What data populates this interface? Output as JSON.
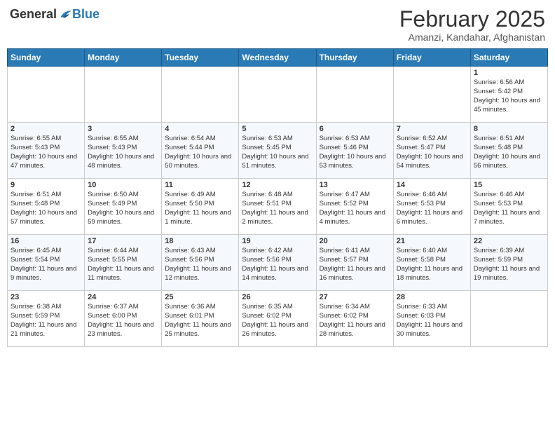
{
  "header": {
    "logo": {
      "general": "General",
      "blue": "Blue",
      "tagline": "GeneralBlue"
    },
    "title": "February 2025",
    "location": "Amanzi, Kandahar, Afghanistan"
  },
  "weekdays": [
    "Sunday",
    "Monday",
    "Tuesday",
    "Wednesday",
    "Thursday",
    "Friday",
    "Saturday"
  ],
  "weeks": [
    [
      {
        "day": "",
        "info": ""
      },
      {
        "day": "",
        "info": ""
      },
      {
        "day": "",
        "info": ""
      },
      {
        "day": "",
        "info": ""
      },
      {
        "day": "",
        "info": ""
      },
      {
        "day": "",
        "info": ""
      },
      {
        "day": "1",
        "info": "Sunrise: 6:56 AM\nSunset: 5:42 PM\nDaylight: 10 hours and 45 minutes."
      }
    ],
    [
      {
        "day": "2",
        "info": "Sunrise: 6:55 AM\nSunset: 5:43 PM\nDaylight: 10 hours and 47 minutes."
      },
      {
        "day": "3",
        "info": "Sunrise: 6:55 AM\nSunset: 5:43 PM\nDaylight: 10 hours and 48 minutes."
      },
      {
        "day": "4",
        "info": "Sunrise: 6:54 AM\nSunset: 5:44 PM\nDaylight: 10 hours and 50 minutes."
      },
      {
        "day": "5",
        "info": "Sunrise: 6:53 AM\nSunset: 5:45 PM\nDaylight: 10 hours and 51 minutes."
      },
      {
        "day": "6",
        "info": "Sunrise: 6:53 AM\nSunset: 5:46 PM\nDaylight: 10 hours and 53 minutes."
      },
      {
        "day": "7",
        "info": "Sunrise: 6:52 AM\nSunset: 5:47 PM\nDaylight: 10 hours and 54 minutes."
      },
      {
        "day": "8",
        "info": "Sunrise: 6:51 AM\nSunset: 5:48 PM\nDaylight: 10 hours and 56 minutes."
      }
    ],
    [
      {
        "day": "9",
        "info": "Sunrise: 6:51 AM\nSunset: 5:48 PM\nDaylight: 10 hours and 57 minutes."
      },
      {
        "day": "10",
        "info": "Sunrise: 6:50 AM\nSunset: 5:49 PM\nDaylight: 10 hours and 59 minutes."
      },
      {
        "day": "11",
        "info": "Sunrise: 6:49 AM\nSunset: 5:50 PM\nDaylight: 11 hours and 1 minute."
      },
      {
        "day": "12",
        "info": "Sunrise: 6:48 AM\nSunset: 5:51 PM\nDaylight: 11 hours and 2 minutes."
      },
      {
        "day": "13",
        "info": "Sunrise: 6:47 AM\nSunset: 5:52 PM\nDaylight: 11 hours and 4 minutes."
      },
      {
        "day": "14",
        "info": "Sunrise: 6:46 AM\nSunset: 5:53 PM\nDaylight: 11 hours and 6 minutes."
      },
      {
        "day": "15",
        "info": "Sunrise: 6:46 AM\nSunset: 5:53 PM\nDaylight: 11 hours and 7 minutes."
      }
    ],
    [
      {
        "day": "16",
        "info": "Sunrise: 6:45 AM\nSunset: 5:54 PM\nDaylight: 11 hours and 9 minutes."
      },
      {
        "day": "17",
        "info": "Sunrise: 6:44 AM\nSunset: 5:55 PM\nDaylight: 11 hours and 11 minutes."
      },
      {
        "day": "18",
        "info": "Sunrise: 6:43 AM\nSunset: 5:56 PM\nDaylight: 11 hours and 12 minutes."
      },
      {
        "day": "19",
        "info": "Sunrise: 6:42 AM\nSunset: 5:56 PM\nDaylight: 11 hours and 14 minutes."
      },
      {
        "day": "20",
        "info": "Sunrise: 6:41 AM\nSunset: 5:57 PM\nDaylight: 11 hours and 16 minutes."
      },
      {
        "day": "21",
        "info": "Sunrise: 6:40 AM\nSunset: 5:58 PM\nDaylight: 11 hours and 18 minutes."
      },
      {
        "day": "22",
        "info": "Sunrise: 6:39 AM\nSunset: 5:59 PM\nDaylight: 11 hours and 19 minutes."
      }
    ],
    [
      {
        "day": "23",
        "info": "Sunrise: 6:38 AM\nSunset: 5:59 PM\nDaylight: 11 hours and 21 minutes."
      },
      {
        "day": "24",
        "info": "Sunrise: 6:37 AM\nSunset: 6:00 PM\nDaylight: 11 hours and 23 minutes."
      },
      {
        "day": "25",
        "info": "Sunrise: 6:36 AM\nSunset: 6:01 PM\nDaylight: 11 hours and 25 minutes."
      },
      {
        "day": "26",
        "info": "Sunrise: 6:35 AM\nSunset: 6:02 PM\nDaylight: 11 hours and 26 minutes."
      },
      {
        "day": "27",
        "info": "Sunrise: 6:34 AM\nSunset: 6:02 PM\nDaylight: 11 hours and 28 minutes."
      },
      {
        "day": "28",
        "info": "Sunrise: 6:33 AM\nSunset: 6:03 PM\nDaylight: 11 hours and 30 minutes."
      },
      {
        "day": "",
        "info": ""
      }
    ]
  ]
}
